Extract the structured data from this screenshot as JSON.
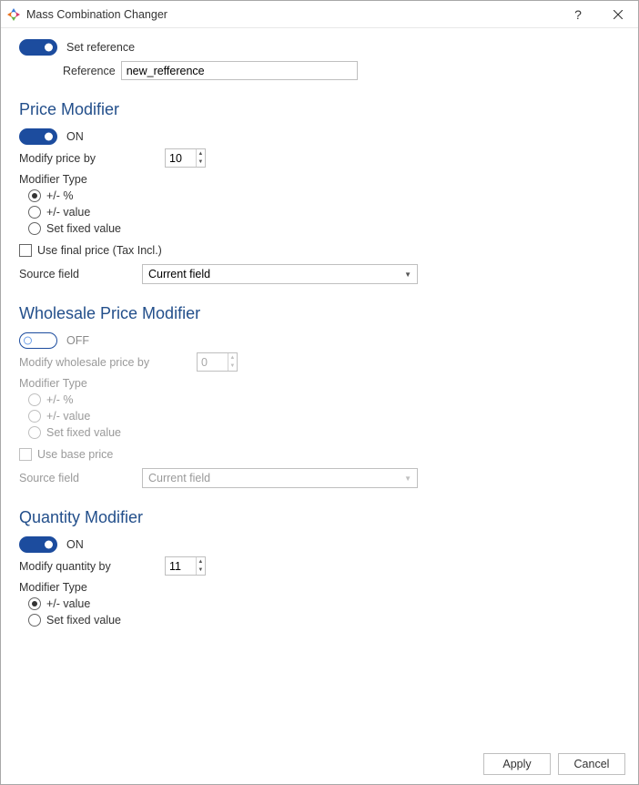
{
  "window": {
    "title": "Mass Combination Changer"
  },
  "reference": {
    "toggle_label": "Set reference",
    "toggle_on": true,
    "field_label": "Reference",
    "value": "new_refference"
  },
  "price": {
    "section_title": "Price Modifier",
    "toggle_on": true,
    "toggle_label": "ON",
    "modify_label": "Modify price by",
    "modify_value": "10",
    "modifier_type_label": "Modifier Type",
    "radios": {
      "percent": "+/- %",
      "value": "+/- value",
      "fixed": "Set fixed value",
      "selected": "percent"
    },
    "use_final_label": "Use final price (Tax Incl.)",
    "use_final_checked": false,
    "source_label": "Source field",
    "source_value": "Current field"
  },
  "wholesale": {
    "section_title": "Wholesale Price Modifier",
    "toggle_on": false,
    "toggle_label": "OFF",
    "modify_label": "Modify wholesale price by",
    "modify_value": "0",
    "modifier_type_label": "Modifier Type",
    "radios": {
      "percent": "+/- %",
      "value": "+/- value",
      "fixed": "Set fixed value"
    },
    "use_base_label": "Use base price",
    "source_label": "Source field",
    "source_value": "Current field"
  },
  "quantity": {
    "section_title": "Quantity Modifier",
    "toggle_on": true,
    "toggle_label": "ON",
    "modify_label": "Modify quantity by",
    "modify_value": "11",
    "modifier_type_label": "Modifier Type",
    "radios": {
      "value": "+/- value",
      "fixed": "Set fixed value",
      "selected": "value"
    }
  },
  "footer": {
    "apply": "Apply",
    "cancel": "Cancel"
  }
}
